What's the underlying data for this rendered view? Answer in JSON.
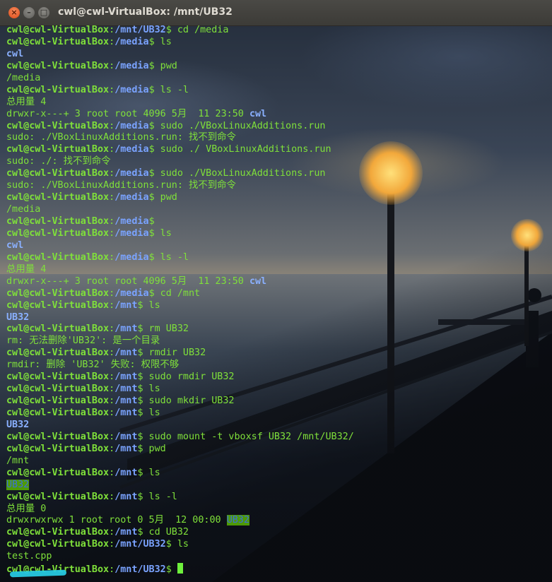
{
  "window": {
    "title": "cwl@cwl-VirtualBox: /mnt/UB32",
    "close_glyph": "×",
    "minimize_glyph": "–",
    "maximize_glyph": "□"
  },
  "colors": {
    "prompt_user": "#7fe03a",
    "prompt_path": "#7aa3ff",
    "output_text": "#7fe03a",
    "directory": "#8ab0ff",
    "other_writable_bg": "#4e9a06",
    "cursor": "#6ef03c",
    "redaction": "#27c9e0"
  },
  "terminal": {
    "lines": [
      [
        {
          "t": "cwl@cwl-VirtualBox",
          "c": "u"
        },
        {
          "t": ":",
          "c": "t"
        },
        {
          "t": "/mnt/UB32",
          "c": "p"
        },
        {
          "t": "$ cd /media",
          "c": "t"
        }
      ],
      [
        {
          "t": "cwl@cwl-VirtualBox",
          "c": "u"
        },
        {
          "t": ":",
          "c": "t"
        },
        {
          "t": "/media",
          "c": "p"
        },
        {
          "t": "$ ls",
          "c": "t"
        }
      ],
      [
        {
          "t": "cwl",
          "c": "d"
        }
      ],
      [
        {
          "t": "cwl@cwl-VirtualBox",
          "c": "u"
        },
        {
          "t": ":",
          "c": "t"
        },
        {
          "t": "/media",
          "c": "p"
        },
        {
          "t": "$ pwd",
          "c": "t"
        }
      ],
      [
        {
          "t": "/media",
          "c": "t"
        }
      ],
      [
        {
          "t": "cwl@cwl-VirtualBox",
          "c": "u"
        },
        {
          "t": ":",
          "c": "t"
        },
        {
          "t": "/media",
          "c": "p"
        },
        {
          "t": "$ ls -l",
          "c": "t"
        }
      ],
      [
        {
          "t": "总用量 4",
          "c": "t"
        }
      ],
      [
        {
          "t": "drwxr-x---+ 3 root root 4096 5月  11 23:50 ",
          "c": "t"
        },
        {
          "t": "cwl",
          "c": "d"
        }
      ],
      [
        {
          "t": "cwl@cwl-VirtualBox",
          "c": "u"
        },
        {
          "t": ":",
          "c": "t"
        },
        {
          "t": "/media",
          "c": "p"
        },
        {
          "t": "$ sudo ./VBoxLinuxAdditions.run",
          "c": "t"
        }
      ],
      [
        {
          "t": "sudo: ./VBoxLinuxAdditions.run: 找不到命令",
          "c": "t"
        }
      ],
      [
        {
          "t": "cwl@cwl-VirtualBox",
          "c": "u"
        },
        {
          "t": ":",
          "c": "t"
        },
        {
          "t": "/media",
          "c": "p"
        },
        {
          "t": "$ sudo ./ VBoxLinuxAdditions.run",
          "c": "t"
        }
      ],
      [
        {
          "t": "sudo: ./: 找不到命令",
          "c": "t"
        }
      ],
      [
        {
          "t": "cwl@cwl-VirtualBox",
          "c": "u"
        },
        {
          "t": ":",
          "c": "t"
        },
        {
          "t": "/media",
          "c": "p"
        },
        {
          "t": "$ sudo ./VBoxLinuxAdditions.run",
          "c": "t"
        }
      ],
      [
        {
          "t": "sudo: ./VBoxLinuxAdditions.run: 找不到命令",
          "c": "t"
        }
      ],
      [
        {
          "t": "cwl@cwl-VirtualBox",
          "c": "u"
        },
        {
          "t": ":",
          "c": "t"
        },
        {
          "t": "/media",
          "c": "p"
        },
        {
          "t": "$ pwd",
          "c": "t"
        }
      ],
      [
        {
          "t": "/media",
          "c": "t"
        }
      ],
      [
        {
          "t": "cwl@cwl-VirtualBox",
          "c": "u"
        },
        {
          "t": ":",
          "c": "t"
        },
        {
          "t": "/media",
          "c": "p"
        },
        {
          "t": "$",
          "c": "t"
        }
      ],
      [
        {
          "t": "cwl@cwl-VirtualBox",
          "c": "u"
        },
        {
          "t": ":",
          "c": "t"
        },
        {
          "t": "/media",
          "c": "p"
        },
        {
          "t": "$ ls",
          "c": "t"
        }
      ],
      [
        {
          "t": "cwl",
          "c": "d"
        }
      ],
      [
        {
          "t": "cwl@cwl-VirtualBox",
          "c": "u"
        },
        {
          "t": ":",
          "c": "t"
        },
        {
          "t": "/media",
          "c": "p"
        },
        {
          "t": "$ ls -l",
          "c": "t"
        }
      ],
      [
        {
          "t": "总用量 4",
          "c": "t"
        }
      ],
      [
        {
          "t": "drwxr-x---+ 3 root root 4096 5月  11 23:50 ",
          "c": "t"
        },
        {
          "t": "cwl",
          "c": "d"
        }
      ],
      [
        {
          "t": "cwl@cwl-VirtualBox",
          "c": "u"
        },
        {
          "t": ":",
          "c": "t"
        },
        {
          "t": "/media",
          "c": "p"
        },
        {
          "t": "$ cd /mnt",
          "c": "t"
        }
      ],
      [
        {
          "t": "cwl@cwl-VirtualBox",
          "c": "u"
        },
        {
          "t": ":",
          "c": "t"
        },
        {
          "t": "/mnt",
          "c": "p"
        },
        {
          "t": "$ ls",
          "c": "t"
        }
      ],
      [
        {
          "t": "UB32",
          "c": "d"
        }
      ],
      [
        {
          "t": "cwl@cwl-VirtualBox",
          "c": "u"
        },
        {
          "t": ":",
          "c": "t"
        },
        {
          "t": "/mnt",
          "c": "p"
        },
        {
          "t": "$ rm UB32",
          "c": "t"
        }
      ],
      [
        {
          "t": "rm: 无法删除'UB32': 是一个目录",
          "c": "t"
        }
      ],
      [
        {
          "t": "cwl@cwl-VirtualBox",
          "c": "u"
        },
        {
          "t": ":",
          "c": "t"
        },
        {
          "t": "/mnt",
          "c": "p"
        },
        {
          "t": "$ rmdir UB32",
          "c": "t"
        }
      ],
      [
        {
          "t": "rmdir: 删除 'UB32' 失败: 权限不够",
          "c": "t"
        }
      ],
      [
        {
          "t": "cwl@cwl-VirtualBox",
          "c": "u"
        },
        {
          "t": ":",
          "c": "t"
        },
        {
          "t": "/mnt",
          "c": "p"
        },
        {
          "t": "$ sudo rmdir UB32",
          "c": "t"
        }
      ],
      [
        {
          "t": "cwl@cwl-VirtualBox",
          "c": "u"
        },
        {
          "t": ":",
          "c": "t"
        },
        {
          "t": "/mnt",
          "c": "p"
        },
        {
          "t": "$ ls",
          "c": "t"
        }
      ],
      [
        {
          "t": "cwl@cwl-VirtualBox",
          "c": "u"
        },
        {
          "t": ":",
          "c": "t"
        },
        {
          "t": "/mnt",
          "c": "p"
        },
        {
          "t": "$ sudo mkdir UB32",
          "c": "t"
        }
      ],
      [
        {
          "t": "cwl@cwl-VirtualBox",
          "c": "u"
        },
        {
          "t": ":",
          "c": "t"
        },
        {
          "t": "/mnt",
          "c": "p"
        },
        {
          "t": "$ ls",
          "c": "t"
        }
      ],
      [
        {
          "t": "UB32",
          "c": "d"
        }
      ],
      [
        {
          "t": "cwl@cwl-VirtualBox",
          "c": "u"
        },
        {
          "t": ":",
          "c": "t"
        },
        {
          "t": "/mnt",
          "c": "p"
        },
        {
          "t": "$ sudo mount -t vboxsf UB32 /mnt/UB32/",
          "c": "t"
        }
      ],
      [
        {
          "t": "cwl@cwl-VirtualBox",
          "c": "u"
        },
        {
          "t": ":",
          "c": "t"
        },
        {
          "t": "/mnt",
          "c": "p"
        },
        {
          "t": "$ pwd",
          "c": "t"
        }
      ],
      [
        {
          "t": "/mnt",
          "c": "t"
        }
      ],
      [
        {
          "t": "cwl@cwl-VirtualBox",
          "c": "u"
        },
        {
          "t": ":",
          "c": "t"
        },
        {
          "t": "/mnt",
          "c": "p"
        },
        {
          "t": "$ ls",
          "c": "t"
        }
      ],
      [
        {
          "t": "UB32",
          "c": "hl"
        }
      ],
      [
        {
          "t": "cwl@cwl-VirtualBox",
          "c": "u"
        },
        {
          "t": ":",
          "c": "t"
        },
        {
          "t": "/mnt",
          "c": "p"
        },
        {
          "t": "$ ls -l",
          "c": "t"
        }
      ],
      [
        {
          "t": "总用量 0",
          "c": "t"
        }
      ],
      [
        {
          "t": "drwxrwxrwx 1 root root 0 5月  12 00:00 ",
          "c": "t"
        },
        {
          "t": "UB32",
          "c": "hl"
        }
      ],
      [
        {
          "t": "cwl@cwl-VirtualBox",
          "c": "u"
        },
        {
          "t": ":",
          "c": "t"
        },
        {
          "t": "/mnt",
          "c": "p"
        },
        {
          "t": "$ cd UB32",
          "c": "t"
        }
      ],
      [
        {
          "t": "cwl@cwl-VirtualBox",
          "c": "u"
        },
        {
          "t": ":",
          "c": "t"
        },
        {
          "t": "/mnt/UB32",
          "c": "p"
        },
        {
          "t": "$ ls",
          "c": "t"
        }
      ],
      [
        {
          "t": "test.cpp",
          "c": "t"
        }
      ],
      [
        {
          "t": "cwl@cwl-VirtualBox",
          "c": "u"
        },
        {
          "t": ":",
          "c": "t"
        },
        {
          "t": "/mnt/UB32",
          "c": "p"
        },
        {
          "t": "$ ",
          "c": "t"
        }
      ]
    ]
  }
}
